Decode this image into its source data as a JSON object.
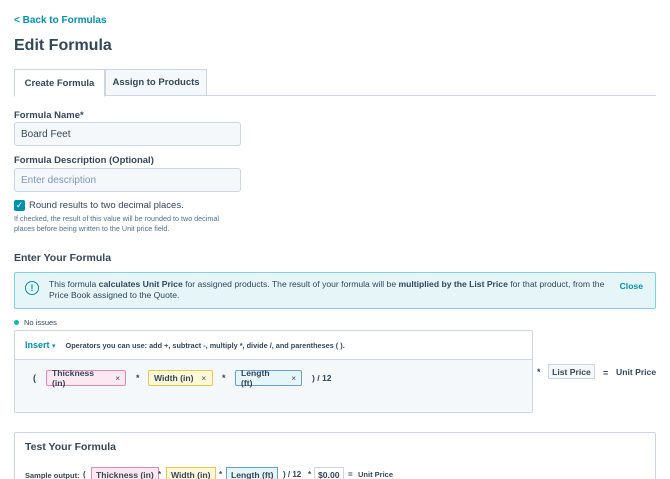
{
  "nav": {
    "back_link": "< Back to Formulas"
  },
  "page": {
    "title": "Edit Formula"
  },
  "tabs": [
    {
      "label": "Create Formula",
      "active": true
    },
    {
      "label": "Assign to Products",
      "active": false
    }
  ],
  "form": {
    "name_label": "Formula Name*",
    "name_value": "Board Feet",
    "description_label": "Formula Description (Optional)",
    "description_placeholder": "Enter description",
    "round_checkbox_label": "Round results to two decimal places.",
    "round_checked": true,
    "round_help": "If checked, the result of this value will be rounded to two decimal places before being written to the Unit price field."
  },
  "formula_section": {
    "title": "Enter Your Formula",
    "alert": {
      "text_1": "This formula ",
      "text_bold_1": "calculates Unit Price",
      "text_2": " for assigned products. The result of your formula will be ",
      "text_bold_2": "multiplied by the List Price",
      "text_3": " for that product, from the Price Book assigned to the Quote.",
      "close_label": "Close"
    },
    "status": "No issues",
    "insert_label": "Insert",
    "operators_hint": "Operators you can use: add +, subtract -, multiply *, divide /, and parentheses ( ).",
    "tokens": [
      "Thickness (in)",
      "Width (in)",
      "Length (ft)"
    ],
    "open_paren": "(",
    "multiply_op": "*",
    "tail": ") / 12",
    "remove_icon": "×",
    "list_price": "List Price",
    "equals": "=",
    "result_label": "Unit Price"
  },
  "test_section": {
    "title": "Test Your Formula",
    "sample_label": "Sample output:",
    "open_paren": "(",
    "tokens": [
      "Thickness (in)",
      "Width (in)",
      "Length (ft)"
    ],
    "multiply_op": "*",
    "tail": ") / 12",
    "price": "$0.00",
    "equals": "=",
    "result_label": "Unit Price"
  },
  "colors": {
    "accent": "#0091ae",
    "text": "#33475b",
    "status_ok": "#00bda5"
  }
}
